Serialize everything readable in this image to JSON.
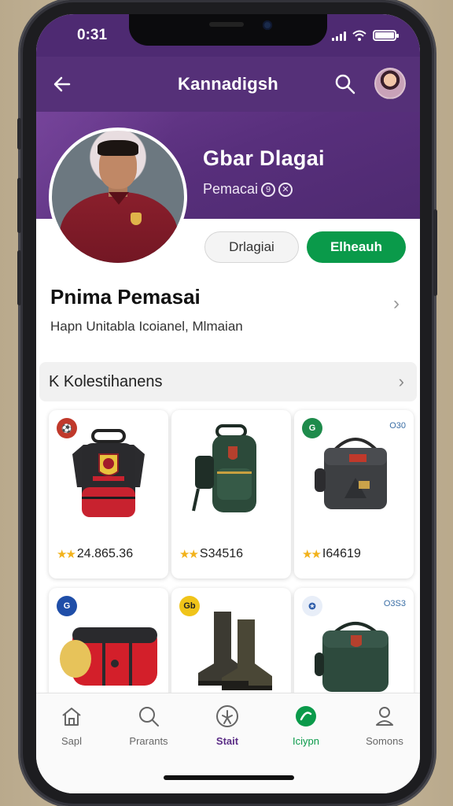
{
  "status_bar": {
    "time": "0:31"
  },
  "app_bar": {
    "title": "Kannadigsh"
  },
  "profile": {
    "name": "Gbar Dlagai",
    "subtitle": "Pemacai",
    "subtitle_badge": "9",
    "subtitle_badge2": "✕"
  },
  "actions": {
    "secondary_label": "Drlagiai",
    "primary_label": "Elheauh"
  },
  "info": {
    "heading": "Pnima Pemasai",
    "description": "Hapn Unitabla Icoianel, Mlmaian"
  },
  "section": {
    "title": "K Kolestihanens"
  },
  "products": [
    {
      "rating": "24.865.36",
      "badge_color": "#c0392b",
      "tag": ""
    },
    {
      "rating": "S34516",
      "badge_color": "",
      "tag": ""
    },
    {
      "rating": "I64619",
      "badge_color": "#1e8b4b",
      "tag": "O30"
    },
    {
      "rating": "",
      "badge_color": "#1f4ea8",
      "tag": ""
    },
    {
      "rating": "",
      "badge_color": "#f0c419",
      "tag": ""
    },
    {
      "rating": "",
      "badge_color": "#2a5aa8",
      "tag": "O3S3"
    }
  ],
  "nav": [
    {
      "label": "Sapl",
      "icon": "home-icon"
    },
    {
      "label": "Prarants",
      "icon": "search-icon"
    },
    {
      "label": "Stait",
      "icon": "star-circle-icon"
    },
    {
      "label": "Iciypn",
      "icon": "green-circle-icon"
    },
    {
      "label": "Somons",
      "icon": "user-icon"
    }
  ],
  "colors": {
    "header_purple": "#553078",
    "accent_green": "#0a9a4a",
    "star_gold": "#f2b21b"
  }
}
